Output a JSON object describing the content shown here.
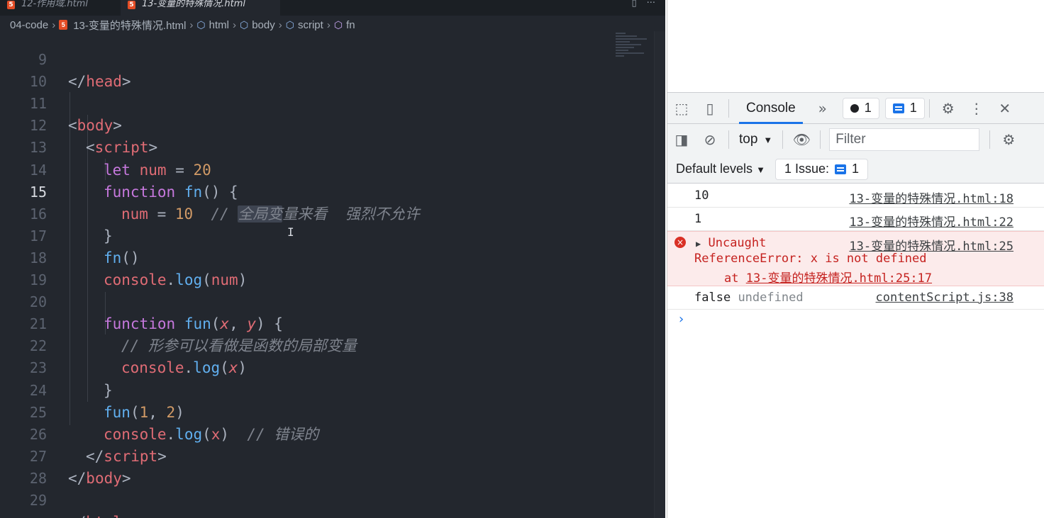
{
  "editor": {
    "tabs": [
      {
        "label": "12-作用域.html"
      },
      {
        "label": "13-变量的特殊情况.html"
      }
    ],
    "tab_actions": {
      "split": "▯",
      "more": "···"
    },
    "breadcrumb": {
      "folder": "04-code",
      "file": "13-变量的特殊情况.html",
      "html": "html",
      "body": "body",
      "script": "script",
      "fn": "fn"
    },
    "lines": {
      "9": {
        "num": "9",
        "t1": "</",
        "t2": "head",
        "t3": ">"
      },
      "10": {
        "num": "10"
      },
      "11": {
        "num": "11",
        "t1": "<",
        "t2": "body",
        "t3": ">"
      },
      "12": {
        "num": "12",
        "t1": "<",
        "t2": "script",
        "t3": ">"
      },
      "13": {
        "num": "13",
        "t1": "let",
        "t2": "num",
        "t3": "=",
        "t4": "20"
      },
      "14": {
        "num": "14",
        "t1": "function",
        "t2": "fn",
        "t3": "() {"
      },
      "15": {
        "num": "15",
        "t1": "num",
        "t2": "=",
        "t3": "10",
        "c1": "// ",
        "c2": "全局变",
        "c3": "量来看  强烈不允许"
      },
      "16": {
        "num": "16",
        "t1": "}"
      },
      "17": {
        "num": "17",
        "t1": "fn",
        "t2": "()"
      },
      "18": {
        "num": "18",
        "t1": "console",
        "t2": ".",
        "t3": "log",
        "t4": "(",
        "t5": "num",
        "t6": ")"
      },
      "19": {
        "num": "19"
      },
      "20": {
        "num": "20",
        "t1": "function",
        "t2": "fun",
        "t3": "(",
        "t4": "x",
        "t5": ", ",
        "t6": "y",
        "t7": ") {"
      },
      "21": {
        "num": "21",
        "c1": "// 形参可以看做是函数的局部变量"
      },
      "22": {
        "num": "22",
        "t1": "console",
        "t2": ".",
        "t3": "log",
        "t4": "(",
        "t5": "x",
        "t6": ")"
      },
      "23": {
        "num": "23",
        "t1": "}"
      },
      "24": {
        "num": "24",
        "t1": "fun",
        "t2": "(",
        "t3": "1",
        "t4": ", ",
        "t5": "2",
        "t6": ")"
      },
      "25": {
        "num": "25",
        "t1": "console",
        "t2": ".",
        "t3": "log",
        "t4": "(",
        "t5": "x",
        "t6": ")",
        "c1": "// 错误的"
      },
      "26": {
        "num": "26",
        "t1": "</",
        "t2": "script",
        "t3": ">"
      },
      "27": {
        "num": "27",
        "t1": "</",
        "t2": "body",
        "t3": ">"
      },
      "28": {
        "num": "28"
      },
      "29": {
        "num": "29",
        "t1": "</",
        "t2": "html",
        "t3": ">"
      }
    },
    "active_line": "15"
  },
  "devtools": {
    "toolbar": {
      "tab": "Console",
      "errors_count": "1",
      "issues_count": "1"
    },
    "console_bar": {
      "context": "top",
      "filter_placeholder": "Filter"
    },
    "levels": {
      "label": "Default levels",
      "issues_label": "1 Issue:",
      "issues_count": "1"
    },
    "messages": [
      {
        "text": "10",
        "source": "13-变量的特殊情况.html:18"
      },
      {
        "text": "1",
        "source": "13-变量的特殊情况.html:22"
      },
      {
        "uncaught": "Uncaught",
        "error": "ReferenceError: x is not defined",
        "at": "at",
        "at_link": "13-变量的特殊情况.html:25:17",
        "source": "13-变量的特殊情况.html:25"
      },
      {
        "text": "false",
        "text2": "undefined",
        "source": "contentScript.js:38"
      }
    ],
    "prompt": "›"
  },
  "colors": {
    "editor_bg": "#23272e",
    "keyword": "#c678dd",
    "variable": "#e06c75",
    "function": "#61afef",
    "number": "#d19a66",
    "comment": "#7f848e",
    "error": "#c5221f",
    "accent": "#1a73e8"
  },
  "icons": [
    "html5-icon",
    "cube-icon",
    "inspect-icon",
    "device-icon",
    "chevron-double-icon",
    "gear-icon",
    "kebab-icon",
    "close-icon",
    "sidebar-icon",
    "clear-icon",
    "eye-icon",
    "error-dot-icon",
    "message-icon",
    "error-x-icon",
    "expand-triangle-icon"
  ]
}
